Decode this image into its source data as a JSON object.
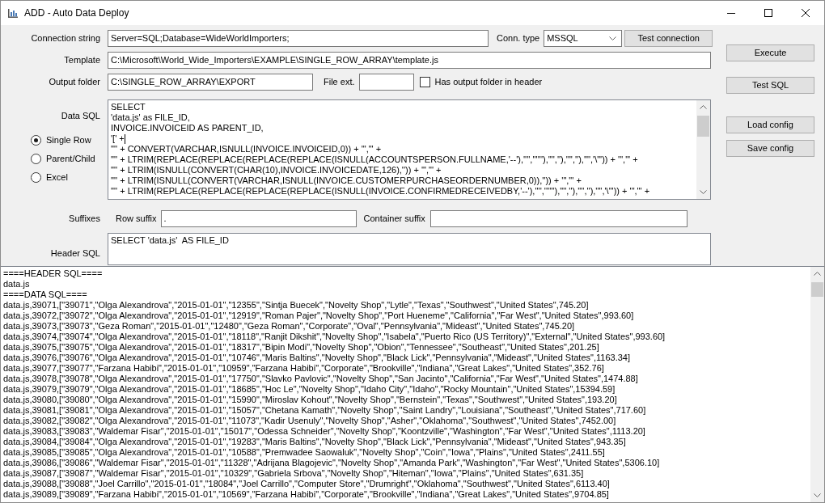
{
  "window": {
    "title": "ADD - Auto Data Deploy"
  },
  "connection_string": {
    "label": "Connection string",
    "value": "Server=SQL;Database=WideWorldImporters;"
  },
  "conn_type": {
    "label": "Conn. type",
    "value": "MSSQL"
  },
  "test_connection_button": "Test connection",
  "template": {
    "label": "Template",
    "value": "C:\\Microsoft\\World_Wide_Importers\\EXAMPLE\\SINGLE_ROW_ARRAY\\template.js"
  },
  "output_folder": {
    "label": "Output folder",
    "value": "C:\\SINGLE_ROW_ARRAY\\EXPORT"
  },
  "file_ext": {
    "label": "File ext."
  },
  "output_folder_in_header": {
    "label": "Has output folder in header",
    "checked": false
  },
  "data_sql": {
    "label": "Data SQL",
    "lines": [
      {
        "text": "SELECT",
        "caret": false
      },
      {
        "text": "'data.js' as FILE_ID,",
        "caret": false
      },
      {
        "text": "INVOICE.INVOICEID AS PARENT_ID,",
        "caret": false
      },
      {
        "text": "'[' +",
        "caret": true
      },
      {
        "text": "'\"' + CONVERT(VARCHAR,ISNULL(INVOICE.INVOICEID,0)) + '\",\"' +",
        "caret": false
      },
      {
        "text": "'\"' + LTRIM(REPLACE(REPLACE(REPLACE(REPLACE(ISNULL(ACCOUNTSPERSON.FULLNAME,'--'),'''',''''''),'\"',''),'\"',''),'\"','\\\"')) + '\",\"' +",
        "caret": false
      },
      {
        "text": "'\"' + LTRIM(ISNULL(CONVERT(CHAR(10),INVOICE.INVOICEDATE,126),'')) + '\",\"' +",
        "caret": false
      },
      {
        "text": "'\"' + LTRIM(ISNULL(CONVERT(VARCHAR,ISNULL(INVOICE.CUSTOMERPURCHASEORDERNUMBER,0)),'')) + '\",\"' +",
        "caret": false
      },
      {
        "text": "'\"' + LTRIM(REPLACE(REPLACE(REPLACE(REPLACE(ISNULL(INVOICE.CONFIRMEDRECEIVEDBY,'--'),'''',''''''),'\"',''),'\"',''),'\"','\\\"')) + '\",\"' +",
        "caret": false
      }
    ]
  },
  "modes": [
    {
      "label": "Single Row",
      "selected": true
    },
    {
      "label": "Parent/Child",
      "selected": false
    },
    {
      "label": "Excel",
      "selected": false
    }
  ],
  "suffixes": {
    "label": "Suffixes",
    "row_suffix": {
      "label": "Row suffix",
      "value": "."
    },
    "container_suffix": {
      "label": "Container suffix"
    }
  },
  "header_sql": {
    "label": "Header SQL",
    "value": "SELECT 'data.js'  AS FILE_ID"
  },
  "side_buttons": [
    "Execute",
    "Test SQL",
    "Load config",
    "Save config"
  ],
  "output": {
    "lines": [
      "====HEADER SQL====",
      "data.js",
      "====DATA SQL====",
      "data.js,39071,[\"39071\",\"Olga Alexandrova\",\"2015-01-01\",\"12355\",\"Sintja Buecek\",\"Novelty Shop\",\"Lytle\",\"Texas\",\"Southwest\",\"United States\",745.20]",
      "data.js,39072,[\"39072\",\"Olga Alexandrova\",\"2015-01-01\",\"12919\",\"Roman Pajer\",\"Novelty Shop\",\"Port Hueneme\",\"California\",\"Far West\",\"United States\",993.60]",
      "data.js,39073,[\"39073\",\"Geza Roman\",\"2015-01-01\",\"12480\",\"Geza Roman\",\"Corporate\",\"Oval\",\"Pennsylvania\",\"Mideast\",\"United States\",745.20]",
      "data.js,39074,[\"39074\",\"Olga Alexandrova\",\"2015-01-01\",\"18118\",\"Ranjit Dikshit\",\"Novelty Shop\",\"Isabela\",\"Puerto Rico (US Territory)\",\"External\",\"United States\",993.60]",
      "data.js,39075,[\"39075\",\"Olga Alexandrova\",\"2015-01-01\",\"18317\",\"Bipin Modi\",\"Novelty Shop\",\"Obion\",\"Tennessee\",\"Southeast\",\"United States\",201.25]",
      "data.js,39076,[\"39076\",\"Olga Alexandrova\",\"2015-01-01\",\"10746\",\"Maris Baltins\",\"Novelty Shop\",\"Black Lick\",\"Pennsylvania\",\"Mideast\",\"United States\",1163.34]",
      "data.js,39077,[\"39077\",\"Farzana Habibi\",\"2015-01-01\",\"10959\",\"Farzana Habibi\",\"Corporate\",\"Brookville\",\"Indiana\",\"Great Lakes\",\"United States\",352.76]",
      "data.js,39078,[\"39078\",\"Olga Alexandrova\",\"2015-01-01\",\"17750\",\"Slavko Pavlovic\",\"Novelty Shop\",\"San Jacinto\",\"California\",\"Far West\",\"United States\",1474.88]",
      "data.js,39079,[\"39079\",\"Olga Alexandrova\",\"2015-01-01\",\"18685\",\"Hoc Le\",\"Novelty Shop\",\"Idaho City\",\"Idaho\",\"Rocky Mountain\",\"United States\",15394.59]",
      "data.js,39080,[\"39080\",\"Olga Alexandrova\",\"2015-01-01\",\"15990\",\"Miroslav Kohout\",\"Novelty Shop\",\"Bernstein\",\"Texas\",\"Southwest\",\"United States\",193.20]",
      "data.js,39081,[\"39081\",\"Olga Alexandrova\",\"2015-01-01\",\"15057\",\"Chetana Kamath\",\"Novelty Shop\",\"Saint Landry\",\"Louisiana\",\"Southeast\",\"United States\",717.60]",
      "data.js,39082,[\"39082\",\"Olga Alexandrova\",\"2015-01-01\",\"11073\",\"Kadir Usenuly\",\"Novelty Shop\",\"Asher\",\"Oklahoma\",\"Southwest\",\"United States\",7452.00]",
      "data.js,39083,[\"39083\",\"Waldemar Fisar\",\"2015-01-01\",\"15017\",\"Odessa Schneider\",\"Novelty Shop\",\"Koontzville\",\"Washington\",\"Far West\",\"United States\",1113.20]",
      "data.js,39084,[\"39084\",\"Olga Alexandrova\",\"2015-01-01\",\"19283\",\"Maris Baltins\",\"Novelty Shop\",\"Black Lick\",\"Pennsylvania\",\"Mideast\",\"United States\",943.35]",
      "data.js,39085,[\"39085\",\"Olga Alexandrova\",\"2015-01-01\",\"10588\",\"Premwadee Saowaluk\",\"Novelty Shop\",\"Coin\",\"Iowa\",\"Plains\",\"United States\",2411.55]",
      "data.js,39086,[\"39086\",\"Waldemar Fisar\",\"2015-01-01\",\"11328\",\"Adrijana Blagojevic\",\"Novelty Shop\",\"Amanda Park\",\"Washington\",\"Far West\",\"United States\",5306.10]",
      "data.js,39087,[\"39087\",\"Waldemar Fisar\",\"2015-01-01\",\"10329\",\"Gabriela Srbova\",\"Novelty Shop\",\"Hiteman\",\"Iowa\",\"Plains\",\"United States\",631.35]",
      "data.js,39088,[\"39088\",\"Joel Carrillo\",\"2015-01-01\",\"18084\",\"Joel Carrillo\",\"Computer Store\",\"Drumright\",\"Oklahoma\",\"Southwest\",\"United States\",6113.40]",
      "data.js,39089,[\"39089\",\"Farzana Habibi\",\"2015-01-01\",\"10569\",\"Farzana Habibi\",\"Corporate\",\"Brookville\",\"Indiana\",\"Great Lakes\",\"United States\",9704.85]"
    ]
  }
}
